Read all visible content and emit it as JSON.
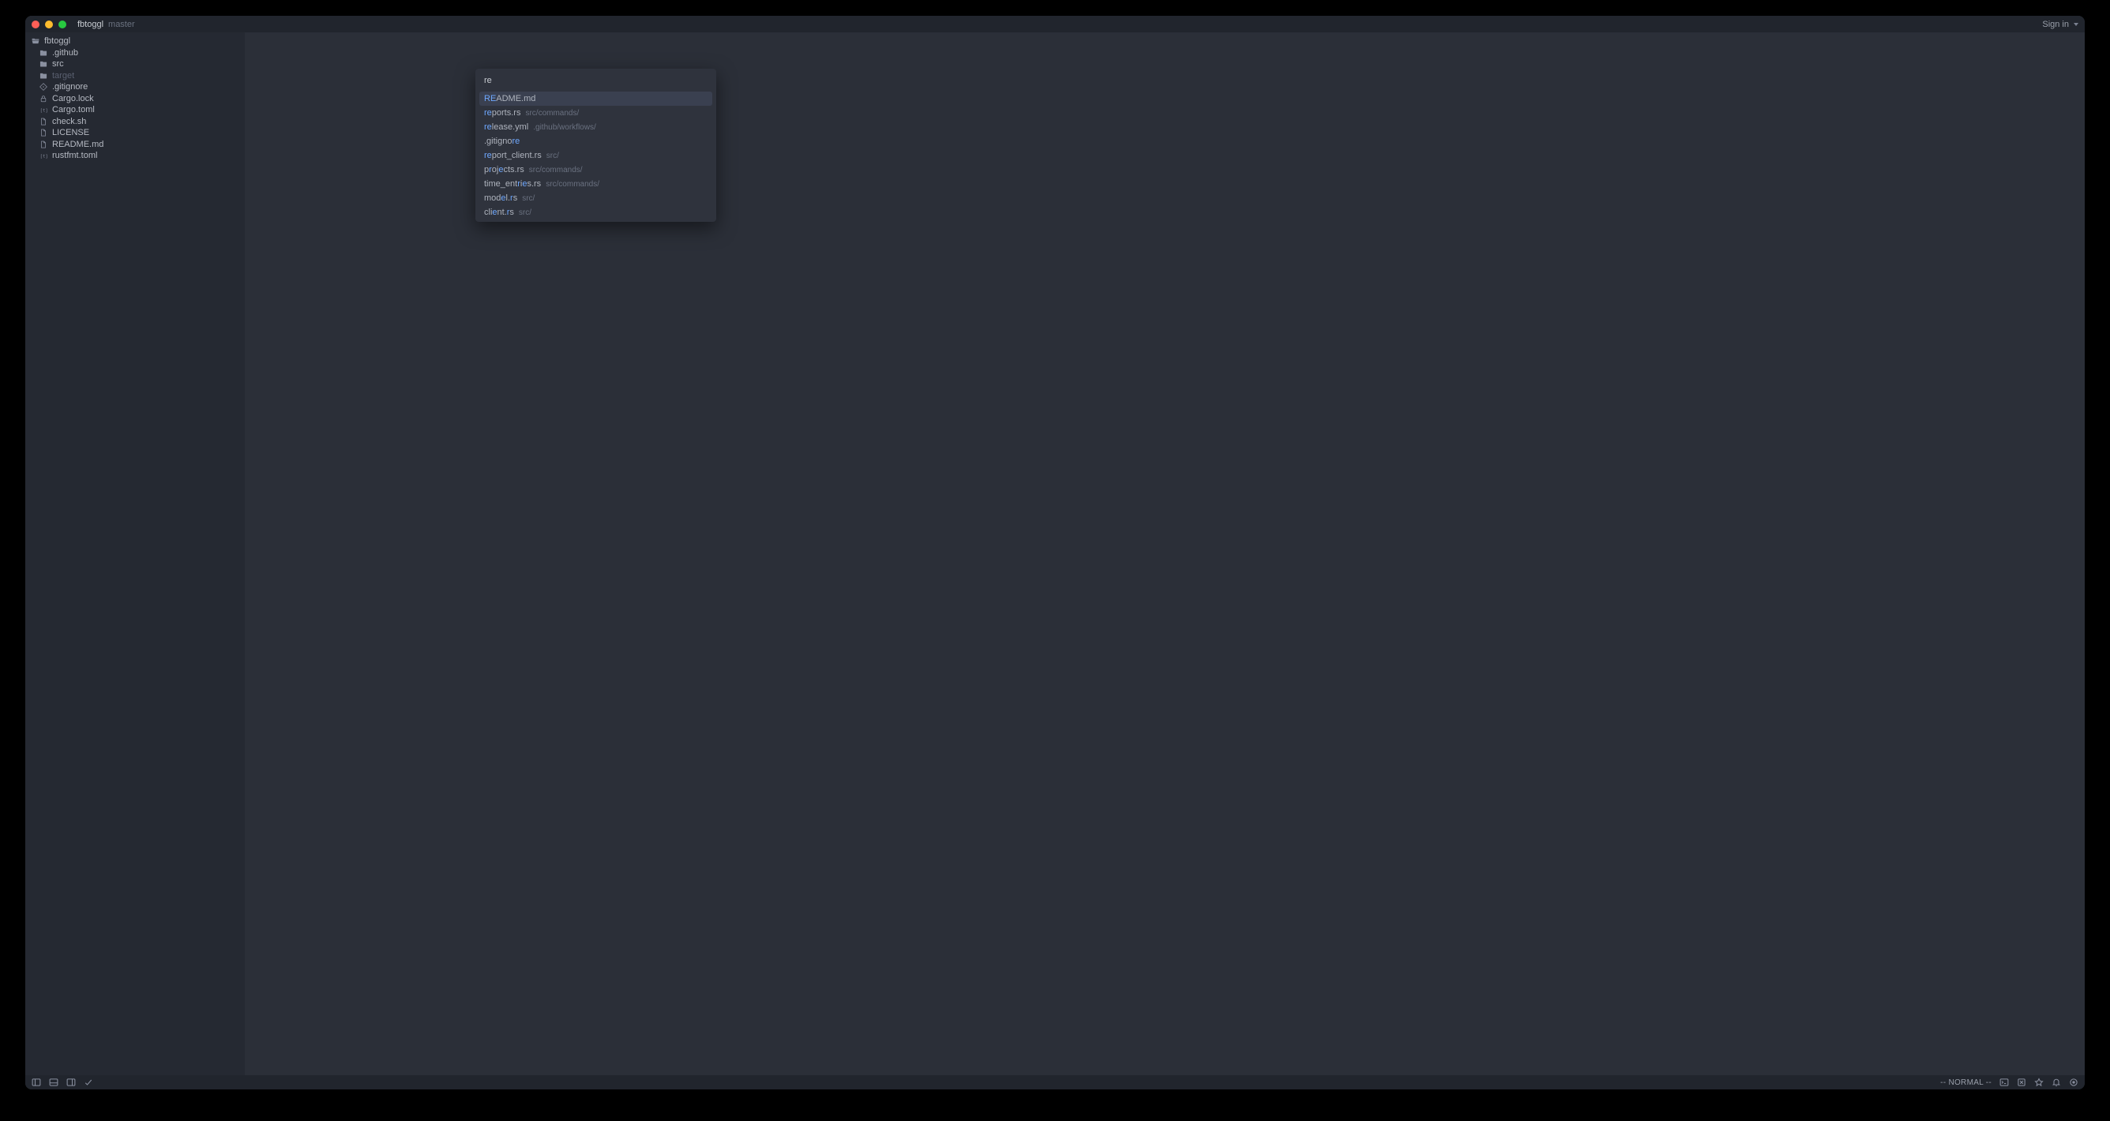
{
  "titlebar": {
    "project": "fbtoggl",
    "branch": "master",
    "sign_in": "Sign in"
  },
  "sidebar": {
    "root": "fbtoggl",
    "items": [
      {
        "icon": "folder",
        "label": ".github",
        "muted": false
      },
      {
        "icon": "folder",
        "label": "src",
        "muted": false
      },
      {
        "icon": "folder",
        "label": "target",
        "muted": true
      },
      {
        "icon": "gitignore",
        "label": ".gitignore",
        "muted": false
      },
      {
        "icon": "lock",
        "label": "Cargo.lock",
        "muted": false
      },
      {
        "icon": "toml",
        "label": "Cargo.toml",
        "muted": false
      },
      {
        "icon": "file",
        "label": "check.sh",
        "muted": false
      },
      {
        "icon": "file",
        "label": "LICENSE",
        "muted": false
      },
      {
        "icon": "file",
        "label": "README.md",
        "muted": false
      },
      {
        "icon": "toml",
        "label": "rustfmt.toml",
        "muted": false
      }
    ]
  },
  "palette": {
    "query": "re",
    "results": [
      {
        "name": "README.md",
        "path": "",
        "highlight_prefix": "RE",
        "rest": "ADME.md",
        "selected": true
      },
      {
        "name": "reports.rs",
        "path": "src/commands/",
        "highlight_prefix": "re",
        "rest": "ports.rs",
        "selected": false
      },
      {
        "name": "release.yml",
        "path": ".github/workflows/",
        "highlight_prefix": "re",
        "rest": "lease.yml",
        "selected": false
      },
      {
        "name": ".gitignore",
        "path": "",
        "highlight_prefix": "",
        "rest": "",
        "selected": false,
        "custom_html": ".gitigno<hl>re</hl>"
      },
      {
        "name": "report_client.rs",
        "path": "src/",
        "highlight_prefix": "re",
        "rest": "port_client.rs",
        "selected": false
      },
      {
        "name": "projects.rs",
        "path": "src/commands/",
        "highlight_prefix": "",
        "rest": "",
        "selected": false,
        "custom_html": "p<hl>r</hl>oj<hl>e</hl>cts.rs"
      },
      {
        "name": "time_entries.rs",
        "path": "src/commands/",
        "highlight_prefix": "",
        "rest": "",
        "selected": false,
        "custom_html": "time_ent<hl>r</hl>i<hl>e</hl>s.rs"
      },
      {
        "name": "model.rs",
        "path": "src/",
        "highlight_prefix": "",
        "rest": "",
        "selected": false,
        "custom_html": "mod<hl>e</hl>l.<hl>r</hl>s"
      },
      {
        "name": "client.rs",
        "path": "src/",
        "highlight_prefix": "",
        "rest": "",
        "selected": false,
        "custom_html": "cli<hl>e</hl>nt.<hl>r</hl>s"
      }
    ]
  },
  "statusbar": {
    "mode": "-- NORMAL --"
  }
}
